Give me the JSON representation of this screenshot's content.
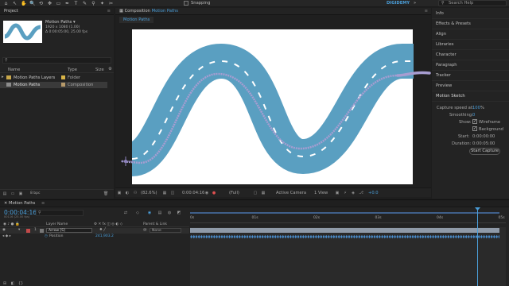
{
  "topbar": {
    "snapping_label": "Snapping",
    "digidemy": "DIGIDEMY",
    "search_placeholder": "Search Help",
    "tools": [
      "⌂",
      "↖",
      "✋",
      "🔍",
      "⟲",
      "✥",
      "▭",
      "✒",
      "T",
      "✎",
      "⚲",
      "✦",
      "✂"
    ]
  },
  "project": {
    "tab": "Project",
    "comp_name": "Motion Paths ▾",
    "comp_res": "1920 x 1080 (1.00)",
    "comp_duration": "Δ 0:00:05:00, 25.00 fps",
    "search_placeholder": "",
    "columns": {
      "name": "Name",
      "type": "Type",
      "size": "Size"
    },
    "rows": [
      {
        "name": "Motion Paths Layers",
        "type": "Folder",
        "color": "#d8b447"
      },
      {
        "name": "Motion Paths",
        "type": "Composition",
        "color": "#b79a6a"
      }
    ],
    "bpc": "8 bpc"
  },
  "composition": {
    "tab_prefix": "Composition",
    "tab_name": "Motion Paths",
    "subtab": "Motion Paths",
    "zoom": "(82.6%)",
    "timecode": "0:00:04:16",
    "resolution": "(Full)",
    "camera": "Active Camera",
    "views": "1 View",
    "exposure": "+0.0"
  },
  "right_panel": {
    "items": [
      "Info",
      "Effects & Presets",
      "Align",
      "Libraries",
      "Character",
      "Paragraph",
      "Tracker",
      "Preview",
      "Motion Sketch"
    ],
    "capture_speed_label": "Capture speed at:",
    "capture_speed_value": "100",
    "capture_speed_unit": "%",
    "smoothing_label": "Smoothing:",
    "smoothing_value": "0",
    "show_label": "Show:",
    "wireframe_label": "Wireframe",
    "background_label": "Background",
    "start_label": "Start:",
    "start_value": "0:00:00:00",
    "duration_label": "Duration:",
    "duration_value": "0:00:05:00",
    "start_capture": "Start Capture"
  },
  "timeline": {
    "tab": "Motion Paths",
    "timecode": "0:00:04:16",
    "timecode_sub": "00116 (25.00 fps)",
    "columns": {
      "layer_name": "Layer Name",
      "parent": "Parent & Link"
    },
    "layer": {
      "index": "1",
      "name": "Arrow [S]",
      "parent": "None"
    },
    "property": {
      "name": "Position",
      "value": "241,903.2"
    },
    "ruler_labels": [
      "0s",
      "01s",
      "02s",
      "03s",
      "04s",
      "05s"
    ]
  },
  "colors": {
    "accent": "#4a9ed9",
    "road": "#5a9fc1",
    "motion_path": "#9a8fc4",
    "layer_bar": "#8f9aa8",
    "workarea": "#3f5f8a"
  }
}
